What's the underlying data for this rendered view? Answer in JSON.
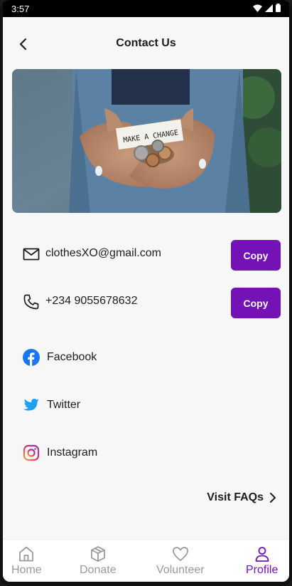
{
  "status_bar": {
    "time": "3:57"
  },
  "header": {
    "title": "Contact Us"
  },
  "contacts": [
    {
      "value": "clothesXO@gmail.com",
      "button": "Copy"
    },
    {
      "value": "+234 9055678632",
      "button": "Copy"
    }
  ],
  "hero": {
    "note_text": "MAKE A CHANGE"
  },
  "socials": [
    {
      "label": "Facebook",
      "icon": "facebook-icon",
      "color": "#1877f2"
    },
    {
      "label": "Twitter",
      "icon": "twitter-icon",
      "color": "#1da1f2"
    },
    {
      "label": "Instagram",
      "icon": "instagram-icon",
      "color": "#e1306c"
    }
  ],
  "faq": {
    "label": "Visit FAQs"
  },
  "nav": {
    "items": [
      {
        "label": "Home",
        "icon": "home-icon"
      },
      {
        "label": "Donate",
        "icon": "box-icon"
      },
      {
        "label": "Volunteer",
        "icon": "heart-icon"
      },
      {
        "label": "Profile",
        "icon": "user-icon"
      }
    ],
    "active": "Profile"
  },
  "colors": {
    "accent": "#7412b8",
    "background": "#f7f7f7"
  }
}
